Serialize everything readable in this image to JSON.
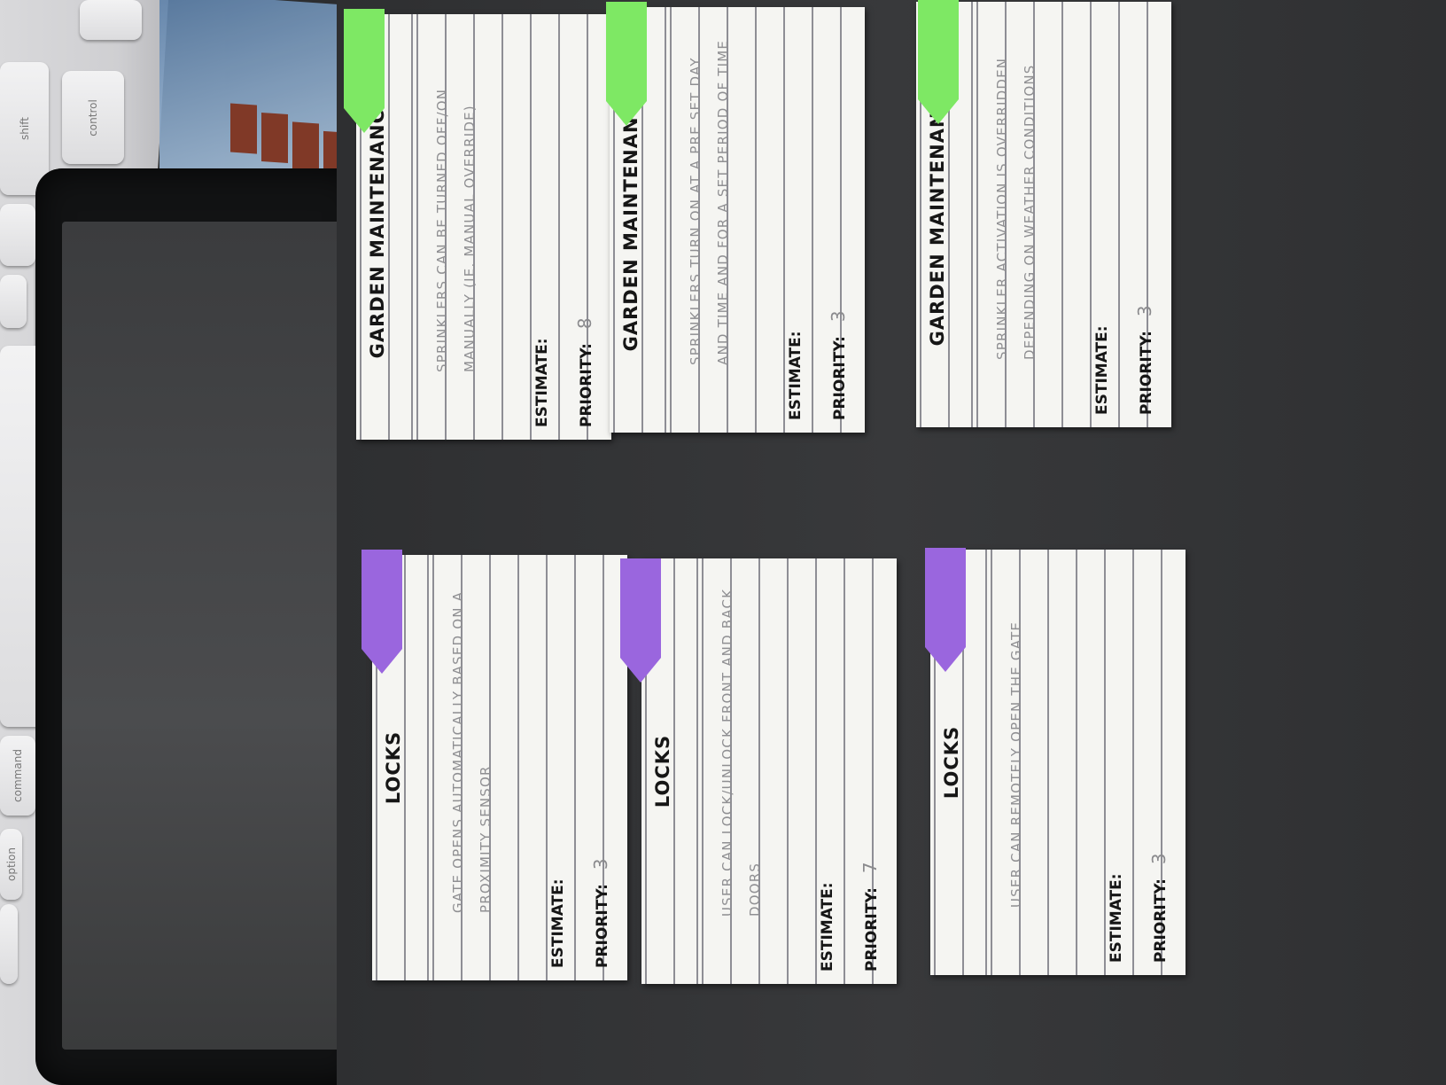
{
  "cards": [
    {
      "id": "garden-1",
      "title": "GARDEN MAINTENANCE",
      "description": "SPRINKLERS CAN BE TURNED OFF/ON MANUALLY (IE. MANUAL OVERRIDE)",
      "estimate_label": "ESTIMATE:",
      "estimate_value": "",
      "priority_label": "PRIORITY:",
      "priority_value": "8",
      "tag_color": "#7ee864"
    },
    {
      "id": "garden-2",
      "title": "GARDEN MAINTENANCE",
      "description": "SPRINKLERS TURN ON AT A PRE SET DAY AND TIME AND FOR A SET PERIOD OF TIME",
      "estimate_label": "ESTIMATE:",
      "estimate_value": "",
      "priority_label": "PRIORITY:",
      "priority_value": "3",
      "tag_color": "#7ee864"
    },
    {
      "id": "garden-3",
      "title": "GARDEN MAINTENANCE",
      "description": "SPRINKLER ACTIVATION IS OVERRIDDEN DEPENDING ON WEATHER CONDITIONS",
      "estimate_label": "ESTIMATE:",
      "estimate_value": "",
      "priority_label": "PRIORITY:",
      "priority_value": "3",
      "tag_color": "#7ee864"
    },
    {
      "id": "locks-1",
      "title": "LOCKS",
      "description": "GATE OPENS AUTOMATICALLY BASED ON A PROXIMITY SENSOR",
      "estimate_label": "ESTIMATE:",
      "estimate_value": "",
      "priority_label": "PRIORITY:",
      "priority_value": "3",
      "tag_color": "#9a66de"
    },
    {
      "id": "locks-2",
      "title": "LOCKS",
      "description": "USER CAN LOCK/UNLOCK FRONT AND BACK DOORS",
      "estimate_label": "ESTIMATE:",
      "estimate_value": "",
      "priority_label": "PRIORITY:",
      "priority_value": "7",
      "tag_color": "#9a66de"
    },
    {
      "id": "locks-3",
      "title": "LOCKS",
      "description": "USER CAN REMOTELY OPEN THE GATE",
      "estimate_label": "ESTIMATE:",
      "estimate_value": "",
      "priority_label": "PRIORITY:",
      "priority_value": "3",
      "tag_color": "#9a66de"
    }
  ],
  "keyboard_keys": [
    "shift",
    "control",
    "option",
    "command",
    "command",
    "option"
  ]
}
